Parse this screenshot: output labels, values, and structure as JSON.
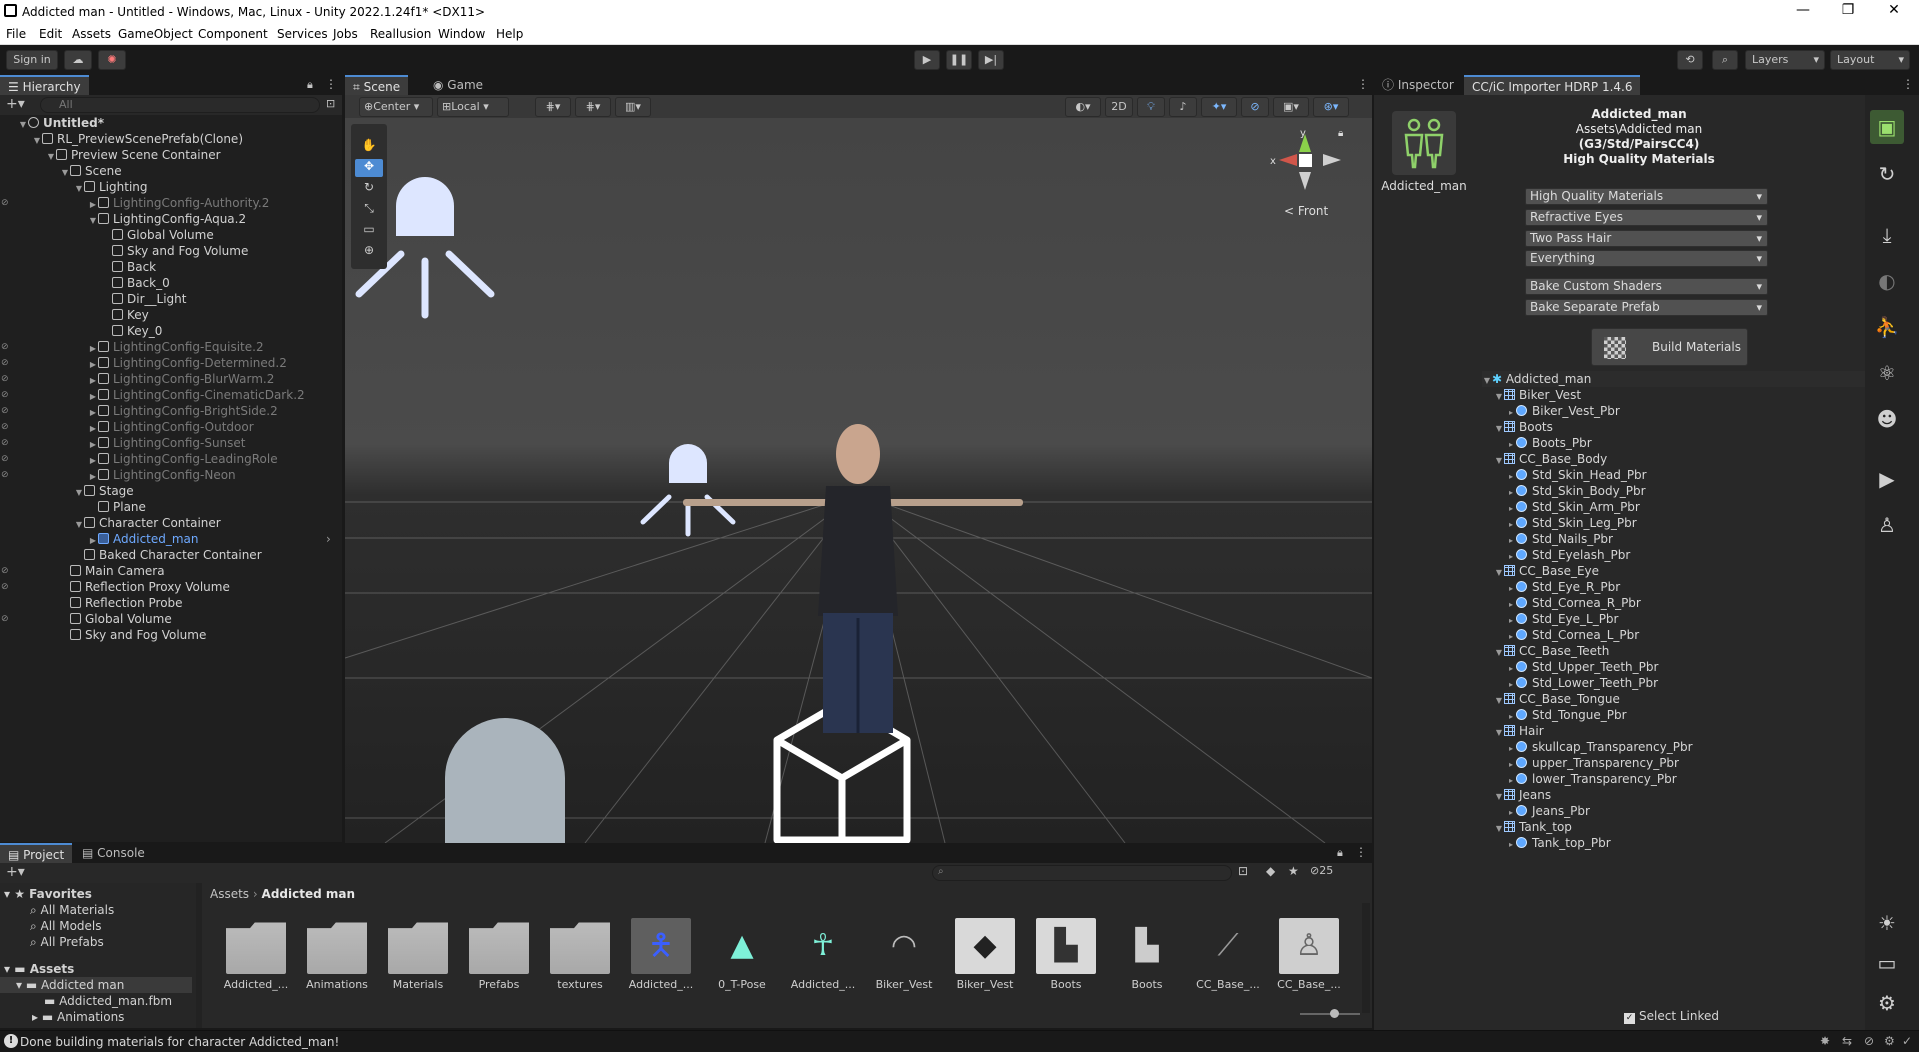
{
  "window": {
    "title": "Addicted man - Untitled - Windows, Mac, Linux - Unity 2022.1.24f1* <DX11>",
    "minimize": "—",
    "maximize": "❐",
    "close": "✕"
  },
  "menu": [
    "File",
    "Edit",
    "Assets",
    "GameObject",
    "Component",
    "Services",
    "Jobs",
    "Reallusion",
    "Window",
    "Help"
  ],
  "toolbar": {
    "sign_in": "Sign in",
    "layers": "Layers",
    "layout": "Layout"
  },
  "hierarchy": {
    "tab": "Hierarchy",
    "search_placeholder": "All",
    "rows": [
      {
        "label": "Untitled*",
        "depth": 0,
        "bold": true
      },
      {
        "label": "RL_PreviewScenePrefab(Clone)",
        "depth": 1
      },
      {
        "label": "Preview Scene Container",
        "depth": 2
      },
      {
        "label": "Scene",
        "depth": 3
      },
      {
        "label": "Lighting",
        "depth": 4
      },
      {
        "label": "LightingConfig-Authority.2",
        "depth": 5,
        "dim": true
      },
      {
        "label": "LightingConfig-Aqua.2",
        "depth": 5
      },
      {
        "label": "Global Volume",
        "depth": 6
      },
      {
        "label": "Sky and Fog Volume",
        "depth": 6
      },
      {
        "label": "Back",
        "depth": 6
      },
      {
        "label": "Back_0",
        "depth": 6
      },
      {
        "label": "Dir__Light",
        "depth": 6
      },
      {
        "label": "Key",
        "depth": 6
      },
      {
        "label": "Key_0",
        "depth": 6
      },
      {
        "label": "LightingConfig-Equisite.2",
        "depth": 5,
        "dim": true
      },
      {
        "label": "LightingConfig-Determined.2",
        "depth": 5,
        "dim": true
      },
      {
        "label": "LightingConfig-BlurWarm.2",
        "depth": 5,
        "dim": true
      },
      {
        "label": "LightingConfig-CinematicDark.2",
        "depth": 5,
        "dim": true
      },
      {
        "label": "LightingConfig-BrightSide.2",
        "depth": 5,
        "dim": true
      },
      {
        "label": "LightingConfig-Outdoor",
        "depth": 5,
        "dim": true
      },
      {
        "label": "LightingConfig-Sunset",
        "depth": 5,
        "dim": true
      },
      {
        "label": "LightingConfig-LeadingRole",
        "depth": 5,
        "dim": true
      },
      {
        "label": "LightingConfig-Neon",
        "depth": 5,
        "dim": true
      },
      {
        "label": "Stage",
        "depth": 4
      },
      {
        "label": "Plane",
        "depth": 5
      },
      {
        "label": "Character Container",
        "depth": 4
      },
      {
        "label": "Addicted_man",
        "depth": 5,
        "sel": true
      },
      {
        "label": "Baked Character Container",
        "depth": 4
      },
      {
        "label": "Main Camera",
        "depth": 3
      },
      {
        "label": "Reflection Proxy Volume",
        "depth": 3
      },
      {
        "label": "Reflection Probe",
        "depth": 3
      },
      {
        "label": "Global Volume",
        "depth": 3
      },
      {
        "label": "Sky and Fog Volume",
        "depth": 3
      }
    ]
  },
  "scene": {
    "tabs": [
      "Scene",
      "Game"
    ],
    "pivot": "Center",
    "space": "Local",
    "mode_2d": "2D",
    "gizmo_view": "Front",
    "gizmo_x": "x",
    "gizmo_y": "y"
  },
  "inspector": {
    "tabs": [
      "Inspector",
      "CC/iC Importer HDRP 1.4.6"
    ],
    "character_name": "Addicted_man",
    "header_line1": "Addicted_man",
    "header_line2": "Assets\\Addicted man",
    "header_line3": "(G3/Std/PairsCC4)",
    "header_line4": "High Quality Materials",
    "dropdowns": [
      "High Quality Materials",
      "Refractive Eyes",
      "Two Pass Hair",
      "Everything"
    ],
    "bake_dropdowns": [
      "Bake Custom Shaders",
      "Bake Separate Prefab"
    ],
    "build_button": "Build Materials",
    "tree": [
      {
        "label": "Addicted_man",
        "kind": "root"
      },
      {
        "label": "Biker_Vest",
        "kind": "mesh"
      },
      {
        "label": "Biker_Vest_Pbr",
        "kind": "mat"
      },
      {
        "label": "Boots",
        "kind": "mesh"
      },
      {
        "label": "Boots_Pbr",
        "kind": "mat"
      },
      {
        "label": "CC_Base_Body",
        "kind": "mesh"
      },
      {
        "label": "Std_Skin_Head_Pbr",
        "kind": "mat"
      },
      {
        "label": "Std_Skin_Body_Pbr",
        "kind": "mat"
      },
      {
        "label": "Std_Skin_Arm_Pbr",
        "kind": "mat"
      },
      {
        "label": "Std_Skin_Leg_Pbr",
        "kind": "mat"
      },
      {
        "label": "Std_Nails_Pbr",
        "kind": "mat"
      },
      {
        "label": "Std_Eyelash_Pbr",
        "kind": "mat"
      },
      {
        "label": "CC_Base_Eye",
        "kind": "mesh"
      },
      {
        "label": "Std_Eye_R_Pbr",
        "kind": "mat"
      },
      {
        "label": "Std_Cornea_R_Pbr",
        "kind": "mat"
      },
      {
        "label": "Std_Eye_L_Pbr",
        "kind": "mat"
      },
      {
        "label": "Std_Cornea_L_Pbr",
        "kind": "mat"
      },
      {
        "label": "CC_Base_Teeth",
        "kind": "mesh"
      },
      {
        "label": "Std_Upper_Teeth_Pbr",
        "kind": "mat"
      },
      {
        "label": "Std_Lower_Teeth_Pbr",
        "kind": "mat"
      },
      {
        "label": "CC_Base_Tongue",
        "kind": "mesh"
      },
      {
        "label": "Std_Tongue_Pbr",
        "kind": "mat"
      },
      {
        "label": "Hair",
        "kind": "mesh"
      },
      {
        "label": "skullcap_Transparency_Pbr",
        "kind": "mat"
      },
      {
        "label": "upper_Transparency_Pbr",
        "kind": "mat"
      },
      {
        "label": "lower_Transparency_Pbr",
        "kind": "mat"
      },
      {
        "label": "Jeans",
        "kind": "mesh"
      },
      {
        "label": "Jeans_Pbr",
        "kind": "mat"
      },
      {
        "label": "Tank_top",
        "kind": "mesh"
      },
      {
        "label": "Tank_top_Pbr",
        "kind": "mat"
      }
    ],
    "select_linked": "Select Linked"
  },
  "project": {
    "tabs": [
      "Project",
      "Console"
    ],
    "favorites_title": "Favorites",
    "favorites": [
      "All Materials",
      "All Models",
      "All Prefabs"
    ],
    "assets_title": "Assets",
    "assets_tree": [
      "Addicted man",
      "Addicted_man.fbm",
      "Animations"
    ],
    "breadcrumb_root": "Assets",
    "breadcrumb_current": "Addicted man",
    "hidden_count": "25",
    "items": [
      {
        "label": "Addicted_...",
        "type": "folder"
      },
      {
        "label": "Animations",
        "type": "folder"
      },
      {
        "label": "Materials",
        "type": "folder"
      },
      {
        "label": "Prefabs",
        "type": "folder"
      },
      {
        "label": "textures",
        "type": "folder"
      },
      {
        "label": "Addicted_...",
        "type": "model"
      },
      {
        "label": "0_T-Pose",
        "type": "anim"
      },
      {
        "label": "Addicted_...",
        "type": "avatar"
      },
      {
        "label": "Biker_Vest",
        "type": "mesh"
      },
      {
        "label": "Biker_Vest",
        "type": "vest"
      },
      {
        "label": "Boots",
        "type": "boots"
      },
      {
        "label": "Boots",
        "type": "boots2"
      },
      {
        "label": "CC_Base_...",
        "type": "skeleton"
      },
      {
        "label": "CC_Base_...",
        "type": "figure"
      }
    ]
  },
  "status": {
    "message": "Done building materials for character Addicted_man!"
  },
  "colors": {
    "accent": "#4d8bd3",
    "selected_text": "#6ea9ff",
    "panel": "#282828",
    "scene_bg": "#444444"
  }
}
